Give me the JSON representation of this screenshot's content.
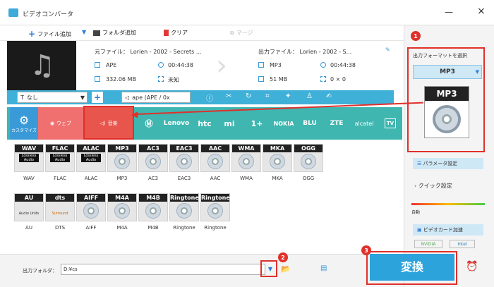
{
  "window": {
    "title": "ビデオコンバータ"
  },
  "toolbar": {
    "add_file": "ファイル追加",
    "add_folder": "フォルダ追加",
    "clear": "クリア",
    "merge": "マージ"
  },
  "file": {
    "source_name": "元ファイル： Lorien - 2002 - Secrets ...",
    "source_format": "APE",
    "source_duration": "00:44:38",
    "source_size": "332.06 MB",
    "source_resolution": "未知",
    "output_name": "出力ファイル： Lorien - 2002 - S...",
    "output_format": "MP3",
    "output_duration": "00:44:38",
    "output_size": "51 MB",
    "output_resolution": "0 × 0"
  },
  "options": {
    "subtitle": "なし",
    "audio_track": "ape (APE / 0x"
  },
  "tabs": {
    "customize": "カスタマイズ",
    "web": "ウェブ",
    "music": "音楽",
    "lenovo": "Lenovo",
    "htc": "htc",
    "mi": "mi",
    "oneplus": "1+",
    "nokia": "NOKIA",
    "blu": "BLU",
    "zte": "ZTE",
    "alcatel": "alcatel",
    "tv": "TV"
  },
  "formats": [
    {
      "label": "WAV",
      "tag": "WAV",
      "lossless": true
    },
    {
      "label": "FLAC",
      "tag": "FLAC",
      "lossless": true
    },
    {
      "label": "ALAC",
      "tag": "ALAC",
      "lossless": true
    },
    {
      "label": "MP3",
      "tag": "MP3",
      "lossless": false
    },
    {
      "label": "AC3",
      "tag": "AC3",
      "lossless": false
    },
    {
      "label": "EAC3",
      "tag": "EAC3",
      "lossless": false
    },
    {
      "label": "AAC",
      "tag": "AAC",
      "lossless": false
    },
    {
      "label": "WMA",
      "tag": "WMA",
      "lossless": false
    },
    {
      "label": "MKA",
      "tag": "MKA",
      "lossless": false
    },
    {
      "label": "OGG",
      "tag": "OGG",
      "lossless": false
    },
    {
      "label": "AU",
      "tag": "AU",
      "lossless": false
    },
    {
      "label": "DTS",
      "tag": "dts",
      "lossless": false
    },
    {
      "label": "AIFF",
      "tag": "AIFF",
      "lossless": false
    },
    {
      "label": "M4A",
      "tag": "M4A",
      "lossless": false
    },
    {
      "label": "M4B",
      "tag": "M4B",
      "lossless": false
    },
    {
      "label": "Ringtone",
      "tag": "Ringtone",
      "lossless": false
    },
    {
      "label": "Ringtone",
      "tag": "Ringtone",
      "lossless": false
    }
  ],
  "format_lossless_text": "Lossless Audio",
  "au_sub": "Audio Units",
  "dts_sub": "Surround",
  "right": {
    "title": "出力フォーマットを選択",
    "format": "MP3",
    "params": "パラメータ設定",
    "quick": "クイック設定",
    "auto": "自動",
    "accel": "ビデオカード加速",
    "nvidia": "NVIDIA",
    "intel": "Intel"
  },
  "bottom": {
    "folder_label": "出力フォルダ：",
    "folder_value": "D:¥cs",
    "convert": "変換"
  },
  "badges": {
    "one": "1",
    "two": "2",
    "three": "3"
  }
}
